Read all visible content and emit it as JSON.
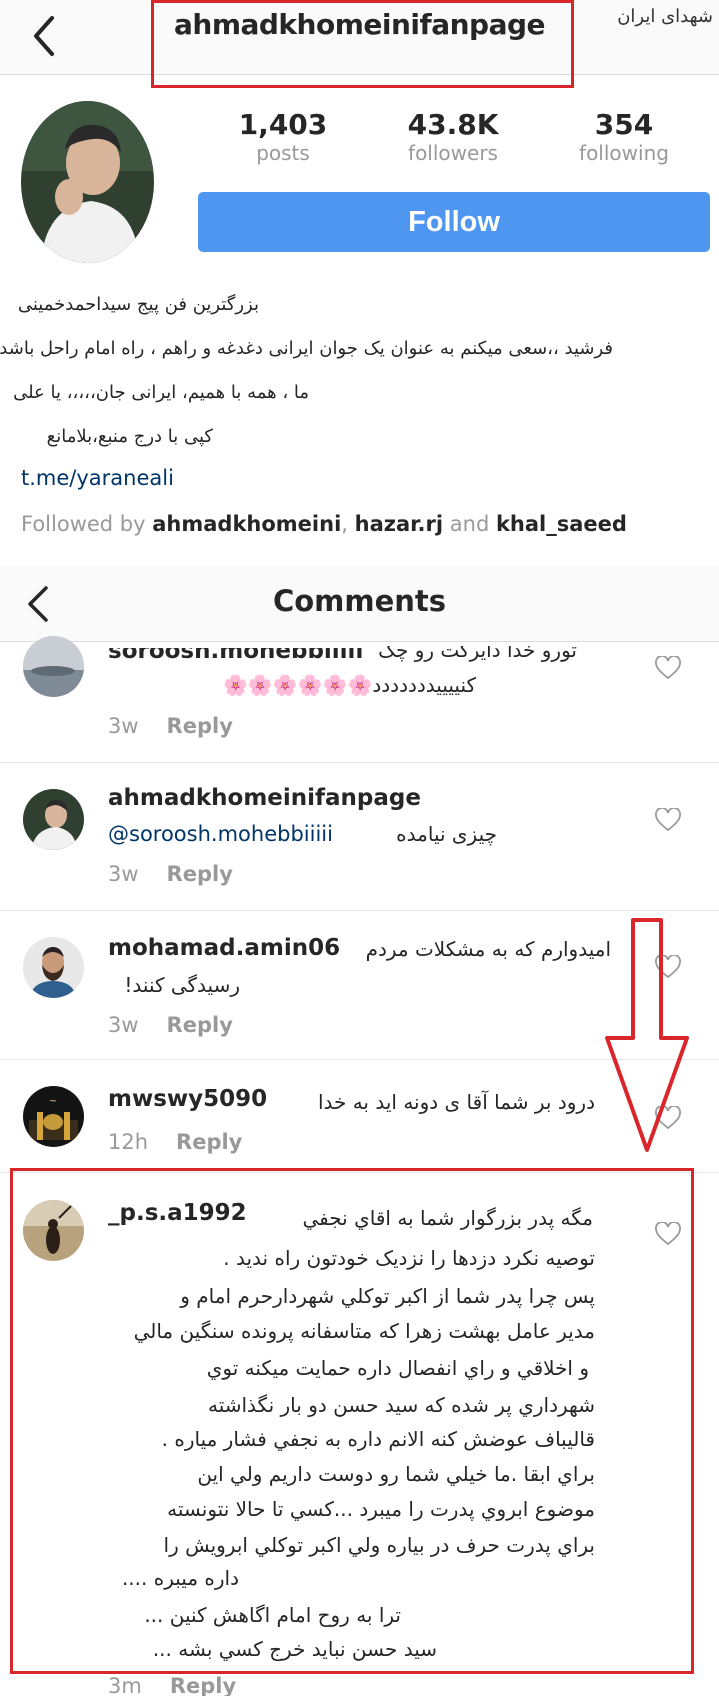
{
  "header": {
    "username": "ahmadkhomeinifanpage",
    "back_label": "Back"
  },
  "watermark": {
    "text": "شهدای ایران"
  },
  "profile": {
    "stats": [
      {
        "value": "1,403",
        "label": "posts"
      },
      {
        "value": "43.8K",
        "label": "followers"
      },
      {
        "value": "354",
        "label": "following"
      }
    ],
    "follow_label": "Follow",
    "bio_lines": [
      "بزرگترین فن پیج سیداحمدخمینی",
      "فرشید ،،سعی میکنم به عنوان یک جوان ایرانی دغدغه و راهم ، راه امام راحل باشد ،،،",
      "ما ، همه با همیم، ایرانی جان،،،،، یا علی",
      "کپی با درج منبع،بلامانع"
    ],
    "link": "t.me/yaraneali",
    "followed_by_prefix": "Followed by",
    "followed_by_users": [
      "ahmadkhomeini",
      "hazar.rj",
      "khal_saeed"
    ],
    "followed_by_separator": ",",
    "followed_by_and": "and"
  },
  "comments": {
    "title": "Comments",
    "reply_label": "Reply",
    "items": [
      {
        "username": "soroosh.mohebbiiiii",
        "lines": [
          "تورو خدا دایرکت رو چک",
          "کنییییددددددد🌸🌸🌸🌸🌸🌸"
        ],
        "time": "3w"
      },
      {
        "username": "ahmadkhomeinifanpage",
        "mention": "@soroosh.mohebbiiiii",
        "lines": [
          "چیزی نیامده"
        ],
        "time": "3w"
      },
      {
        "username": "mohamad.amin06",
        "lines": [
          "امیدوارم که به مشکلات مردم",
          "رسیدگی کنند!"
        ],
        "time": "3w"
      },
      {
        "username": "mwswy5090",
        "lines": [
          "درود بر شما آقا ی دونه اید به خدا"
        ],
        "time": "12h"
      },
      {
        "username": "_p.s.a1992",
        "lines": [
          "مگه پدر بزرگوار شما به اقاي نجفي",
          "توصیه نکرد دزدها را نزدیک خودتون راه ندید .",
          "پس چرا پدر شما از اکبر توکلي شهردارحرم امام و",
          "مدير عامل بهشت زهرا که متاسفانه پرونده سنگين مالي",
          "و اخلاقي و راي انفصال داره حمايت ميکنه توي",
          "شهرداري پر شده که سيد حسن دو بار نگذاشته",
          "قاليباف عوضش کنه الانم داره به نجفي  فشار مياره .",
          "براي ابقا .ما خيلي شما رو دوست داريم ولي اين",
          "موضوع ابروي پدرت را ميبرد ...کسي تا حالا نتونسته",
          "براي پدرت حرف در بياره ولي اکبر توکلي ابرويش را",
          "داره ميبره ....",
          "ترا به روح امام اگاهش کنين ...",
          "سيد حسن نبايد خرج کسي بشه ..."
        ],
        "time": "3m"
      }
    ]
  },
  "colors": {
    "accent": "#4e96f0",
    "highlight": "#d9262b",
    "muted": "#999999",
    "link": "#003569"
  }
}
